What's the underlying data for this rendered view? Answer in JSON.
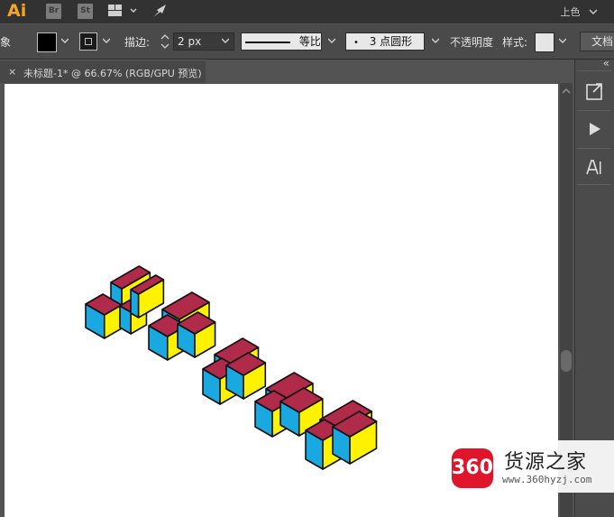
{
  "menubar": {
    "app_logo": "Ai",
    "bridge_label": "Br",
    "stock_label": "St",
    "workspace_label": "上色"
  },
  "control_bar": {
    "left_cut_label": "象",
    "stroke_label": "描边:",
    "stroke_weight": "2 px",
    "profile_label": "等比",
    "brush_label": "3 点圆形",
    "opacity_label": "不透明度",
    "style_label": "样式:",
    "document_button": "文档"
  },
  "document": {
    "tab_title": "未标题-1* @ 66.67% (RGB/GPU 预览)",
    "close_glyph": "×"
  },
  "right_panel": {
    "collapse_glyph": "«"
  },
  "watermark": {
    "badge_text": "360",
    "site_name": "货源之家",
    "site_url": "www.360hyzj.com"
  },
  "colors": {
    "cube_top": "#b02a4a",
    "cube_left": "#1aa8e0",
    "cube_right": "#fff200",
    "outline": "#111111"
  }
}
